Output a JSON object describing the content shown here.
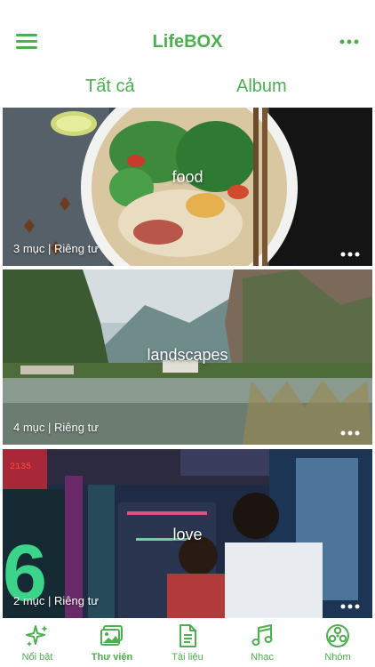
{
  "header": {
    "title": "LifeBOX"
  },
  "tabs": [
    {
      "label": "Tất cả"
    },
    {
      "label": "Album"
    }
  ],
  "albums": [
    {
      "name": "food",
      "meta": "3 mục | Riêng tư"
    },
    {
      "name": "landscapes",
      "meta": "4 mục | Riêng tư"
    },
    {
      "name": "love",
      "meta": "2 mục | Riêng tư"
    }
  ],
  "bottom_nav": [
    {
      "label": "Nổi bật",
      "icon": "sparkle-icon"
    },
    {
      "label": "Thư viện",
      "icon": "gallery-icon",
      "active": true
    },
    {
      "label": "Tài liệu",
      "icon": "document-icon"
    },
    {
      "label": "Nhạc",
      "icon": "music-icon"
    },
    {
      "label": "Nhóm",
      "icon": "group-icon"
    }
  ],
  "colors": {
    "accent": "#4caf50",
    "background": "#ffffff"
  }
}
